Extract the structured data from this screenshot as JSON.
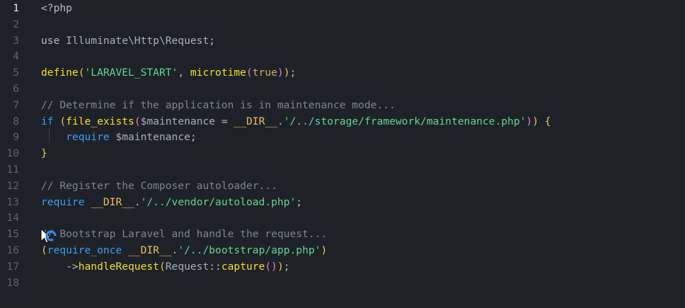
{
  "editor": {
    "language": "php",
    "active_line": 1,
    "lines": [
      {
        "n": "1",
        "tokens": [
          {
            "t": "<?php",
            "c": "pun"
          }
        ]
      },
      {
        "n": "2",
        "tokens": []
      },
      {
        "n": "3",
        "tokens": [
          {
            "t": "use ",
            "c": "pun"
          },
          {
            "t": "Illuminate\\Http\\Request",
            "c": "cls"
          },
          {
            "t": ";",
            "c": "pun"
          }
        ]
      },
      {
        "n": "4",
        "tokens": []
      },
      {
        "n": "5",
        "tokens": [
          {
            "t": "define",
            "c": "fn"
          },
          {
            "t": "(",
            "c": "p1"
          },
          {
            "t": "'LARAVEL_START'",
            "c": "str"
          },
          {
            "t": ", ",
            "c": "pun"
          },
          {
            "t": "microtime",
            "c": "fn"
          },
          {
            "t": "(",
            "c": "p2"
          },
          {
            "t": "true",
            "c": "bool"
          },
          {
            "t": ")",
            "c": "p2"
          },
          {
            "t": ")",
            "c": "p1"
          },
          {
            "t": ";",
            "c": "pun"
          }
        ]
      },
      {
        "n": "6",
        "tokens": []
      },
      {
        "n": "7",
        "tokens": [
          {
            "t": "// Determine if the application is in maintenance mode...",
            "c": "cmt"
          }
        ]
      },
      {
        "n": "8",
        "tokens": [
          {
            "t": "if",
            "c": "kw"
          },
          {
            "t": " ",
            "c": "pun"
          },
          {
            "t": "(",
            "c": "p1"
          },
          {
            "t": "file_exists",
            "c": "fn"
          },
          {
            "t": "(",
            "c": "p2"
          },
          {
            "t": "$maintenance",
            "c": "var"
          },
          {
            "t": " = ",
            "c": "pun"
          },
          {
            "t": "__DIR__",
            "c": "const"
          },
          {
            "t": ".",
            "c": "pun"
          },
          {
            "t": "'/../storage/framework/maintenance.php'",
            "c": "str"
          },
          {
            "t": ")",
            "c": "p2"
          },
          {
            "t": ")",
            "c": "p1"
          },
          {
            "t": " ",
            "c": "pun"
          },
          {
            "t": "{",
            "c": "p1"
          }
        ]
      },
      {
        "n": "9",
        "tokens": [
          {
            "t": "    ",
            "c": "pun"
          },
          {
            "t": "require",
            "c": "kw"
          },
          {
            "t": " $maintenance",
            "c": "var"
          },
          {
            "t": ";",
            "c": "pun"
          }
        ]
      },
      {
        "n": "10",
        "tokens": [
          {
            "t": "}",
            "c": "p1"
          }
        ]
      },
      {
        "n": "11",
        "tokens": []
      },
      {
        "n": "12",
        "tokens": [
          {
            "t": "// Register the Composer autoloader...",
            "c": "cmt"
          }
        ]
      },
      {
        "n": "13",
        "tokens": [
          {
            "t": "require",
            "c": "kw"
          },
          {
            "t": " ",
            "c": "pun"
          },
          {
            "t": "__DIR__",
            "c": "const"
          },
          {
            "t": ".",
            "c": "pun"
          },
          {
            "t": "'/../vendor/autoload.php'",
            "c": "str"
          },
          {
            "t": ";",
            "c": "pun"
          }
        ]
      },
      {
        "n": "14",
        "tokens": []
      },
      {
        "n": "15",
        "tokens": [
          {
            "t": "// Bootstrap Laravel and handle the request...",
            "c": "cmt"
          }
        ]
      },
      {
        "n": "16",
        "tokens": [
          {
            "t": "(",
            "c": "p1"
          },
          {
            "t": "require_once",
            "c": "kw"
          },
          {
            "t": " ",
            "c": "pun"
          },
          {
            "t": "__DIR__",
            "c": "const"
          },
          {
            "t": ".",
            "c": "pun"
          },
          {
            "t": "'/../bootstrap/app.php'",
            "c": "str"
          },
          {
            "t": ")",
            "c": "p1"
          }
        ]
      },
      {
        "n": "17",
        "tokens": [
          {
            "t": "    ->",
            "c": "pun"
          },
          {
            "t": "handleRequest",
            "c": "fn"
          },
          {
            "t": "(",
            "c": "p1"
          },
          {
            "t": "Request",
            "c": "cls"
          },
          {
            "t": "::",
            "c": "pun"
          },
          {
            "t": "capture",
            "c": "fn"
          },
          {
            "t": "(",
            "c": "p2"
          },
          {
            "t": ")",
            "c": "p2"
          },
          {
            "t": ")",
            "c": "p1"
          },
          {
            "t": ";",
            "c": "pun"
          }
        ]
      },
      {
        "n": "18",
        "tokens": []
      }
    ]
  },
  "colors": {
    "background": "#1e2228",
    "keyword": "#3d9bf3",
    "function": "#f2dd2c",
    "string": "#62d491",
    "comment": "#7c8392",
    "cursor_ring": "#2f8cf0"
  },
  "cursor": {
    "icon": "busy-pointer-icon"
  }
}
